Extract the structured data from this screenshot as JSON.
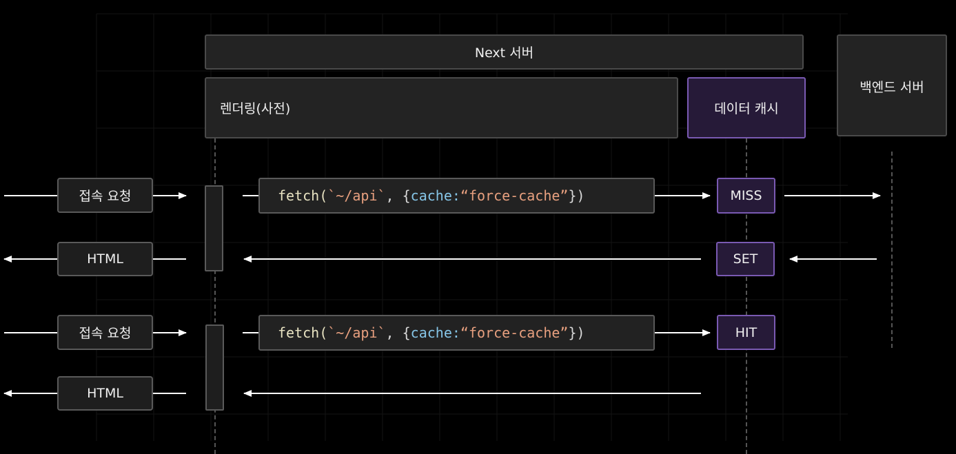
{
  "headers": {
    "next_server": "Next 서버",
    "rendering": "렌더링(사전)",
    "data_cache": "데이터 캐시",
    "backend_server": "백엔드 서버"
  },
  "rows": {
    "request_label": "접속 요청",
    "html_label": "HTML",
    "fetch": {
      "fn": "fetch(",
      "url": "`~/api`",
      "sep": ", {",
      "key": "cache:",
      "value": "“force-cache”",
      "close": "})"
    },
    "miss": "MISS",
    "set": "SET",
    "hit": "HIT"
  },
  "colors": {
    "background": "#000000",
    "box_fill": "#232323",
    "box_border": "#4a4a4a",
    "cache_fill": "#261a38",
    "cache_border": "#7a5ab3",
    "arrow": "#ffffff",
    "string": "#e8a07f",
    "keyword": "#86c6e8"
  }
}
